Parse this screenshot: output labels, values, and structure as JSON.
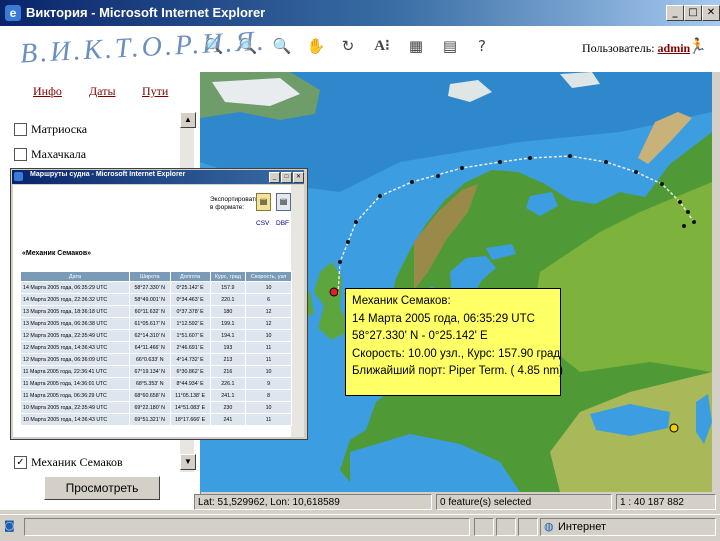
{
  "window": {
    "title": "Виктория - Microsoft Internet Explorer",
    "min": "_",
    "max": "□",
    "close": "✕"
  },
  "app": {
    "logo": "В.И.К.Т.О.Р.И.Я.",
    "nav": [
      "Инфо",
      "Даты",
      "Пути"
    ],
    "user_label": "Пользователь:",
    "user_name": "admin",
    "toolbar_icons": [
      "zoom-in-icon",
      "zoom-out-icon",
      "zoom-region-icon",
      "pan-hand-icon",
      "refresh-icon",
      "text-info-icon",
      "layers-icon",
      "print-icon",
      "help-icon"
    ]
  },
  "vessels": [
    {
      "label": "Матриоска",
      "checked": false
    },
    {
      "label": "Махачкала",
      "checked": false
    },
    {
      "label": "Механик Семаков",
      "checked": true
    }
  ],
  "view_button": "Просмотреть",
  "popup": {
    "title": "Маршруты судна - Microsoft Internet Explorer",
    "export_label_1": "Экспортировать",
    "export_label_2": "в формате:",
    "export_csv": "CSV",
    "export_dbf": "DBF",
    "vessel": "«Механик Семаков»",
    "columns": [
      "Дата",
      "Широта",
      "Долгота",
      "Курс, град",
      "Скорость, узл"
    ],
    "rows": [
      [
        "14 Марта 2005 года, 06:35:29 UTC",
        "58°27.330' N",
        "0°25.142' E",
        "157.9",
        "10"
      ],
      [
        "14 Марта 2005 года, 22:36:32 UTC",
        "58°49.001' N",
        "0°34.463' E",
        "220.1",
        "6"
      ],
      [
        "13 Марта 2005 года, 18:36:18 UTC",
        "60°11.632' N",
        "0°37.378' E",
        "180",
        "12"
      ],
      [
        "13 Марта 2005 года, 06:36:38 UTC",
        "61°05.617' N",
        "1°12.592' E",
        "199.1",
        "12"
      ],
      [
        "12 Марта 2005 года, 22:35:49 UTC",
        "62°14.310' N",
        "1°51.607' E",
        "194.1",
        "10"
      ],
      [
        "12 Марта 2005 года, 14:36:43 UTC",
        "64°11.466' N",
        "2°46.691' E",
        "193",
        "11"
      ],
      [
        "12 Марта 2005 года, 06:36:09 UTC",
        "66°0.633' N",
        "4°14.732' E",
        "213",
        "11"
      ],
      [
        "11 Марта 2005 года, 22:36:41 UTC",
        "67°19.134' N",
        "6°30.862' E",
        "216",
        "10"
      ],
      [
        "11 Марта 2005 года, 14:36:01 UTC",
        "68°5.353' N",
        "8°44.934' E",
        "226.1",
        "9"
      ],
      [
        "11 Марта 2005 года, 06:36:29 UTC",
        "68°60.658' N",
        "11°05.138' E",
        "241.1",
        "8"
      ],
      [
        "10 Марта 2005 года, 22:35:49 UTC",
        "69°22.180' N",
        "14°51.083' E",
        "230",
        "10"
      ],
      [
        "10 Марта 2005 года, 14:36:43 UTC",
        "69°51.321' N",
        "18°17.666' E",
        "241",
        "11"
      ]
    ]
  },
  "tooltip": {
    "line1": "Механик Семаков:",
    "line2": "14 Марта 2005  года, 06:35:29 UTC",
    "line3": "58°27.330' N - 0°25.142' E",
    "line4": "Скорость: 10.00 узл., Курс: 157.90 град",
    "line5": "Ближайший порт: Piper Term. ( 4.85 nm)"
  },
  "map_status": {
    "coords": "Lat: 51,529962, Lon: 10,618589",
    "selected": "0 feature(s) selected",
    "scale": "1 : 40 187 882"
  },
  "ie_status": {
    "zone": "Интернет"
  },
  "colors": {
    "sea": "#3c9ee0",
    "land": "#4f9a36",
    "tooltip": "#ffff66",
    "link": "#800000"
  }
}
